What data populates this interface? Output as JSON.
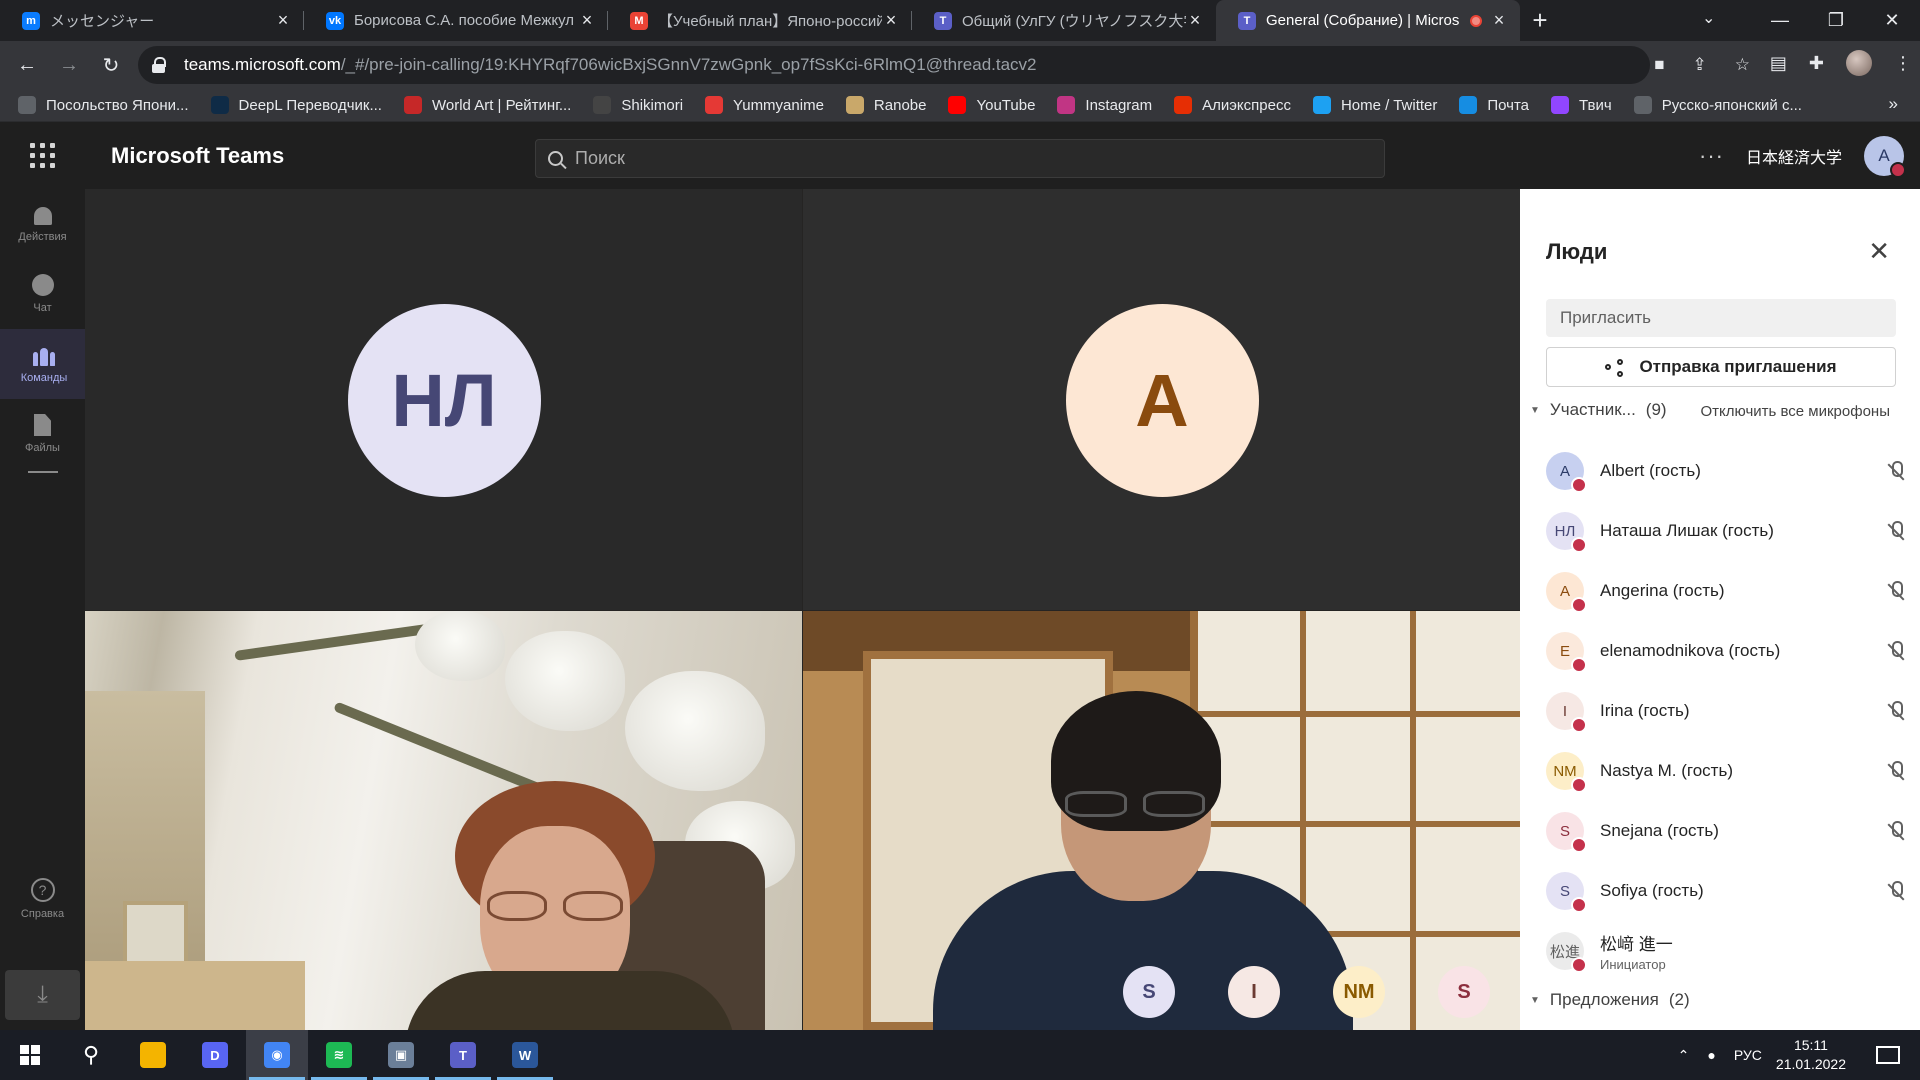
{
  "browser": {
    "tabs": [
      {
        "title": "メッセンジャー",
        "icon": "messenger-icon",
        "color": "#0a7cff",
        "letter": "m"
      },
      {
        "title": "Борисова С.А. пособие Межкул",
        "icon": "vk-icon",
        "color": "#0077ff",
        "letter": "vk"
      },
      {
        "title": "【Учебный план】Японо-россий",
        "icon": "gmail-icon",
        "color": "#ea4335",
        "letter": "M"
      },
      {
        "title": "Общий (УлГУ (ウリヤノフスク大学)",
        "icon": "teams-icon",
        "color": "#5b5fc7",
        "letter": "T"
      },
      {
        "title": "General (Собрание) | Micros",
        "icon": "teams-icon",
        "color": "#5b5fc7",
        "letter": "T"
      }
    ],
    "url_host": "teams.microsoft.com",
    "url_path": "/_#/pre-join-calling/19:KHYRqf706wicBxjSGnnV7zwGpnk_op7fSsKci-6RlmQ1@thread.tacv2",
    "bookmarks": [
      {
        "label": "Посольство Япони...",
        "icon": "globe-icon",
        "color": "#5f6368"
      },
      {
        "label": "DeepL Переводчик...",
        "icon": "deepl-icon",
        "color": "#0f2b46"
      },
      {
        "label": "World Art | Рейтинг...",
        "icon": "worldart-icon",
        "color": "#c62828"
      },
      {
        "label": "Shikimori",
        "icon": "shikimori-icon",
        "color": "#444"
      },
      {
        "label": "Yummyanime",
        "icon": "yummyanime-icon",
        "color": "#e53935"
      },
      {
        "label": "Ranobe",
        "icon": "ranobe-icon",
        "color": "#c9a86a"
      },
      {
        "label": "YouTube",
        "icon": "youtube-icon",
        "color": "#ff0000"
      },
      {
        "label": "Instagram",
        "icon": "instagram-icon",
        "color": "#c13584"
      },
      {
        "label": "Алиэкспресс",
        "icon": "aliexpress-icon",
        "color": "#e62e04"
      },
      {
        "label": "Home / Twitter",
        "icon": "twitter-icon",
        "color": "#1da1f2"
      },
      {
        "label": "Почта",
        "icon": "mail-icon",
        "color": "#168de2"
      },
      {
        "label": "Твич",
        "icon": "twitch-icon",
        "color": "#9146ff"
      },
      {
        "label": "Русско-японский с...",
        "icon": "globe-icon",
        "color": "#5f6368"
      }
    ],
    "bookmarks_more": "»"
  },
  "teams": {
    "app_name": "Microsoft Teams",
    "search_placeholder": "Поиск",
    "org_name": "日本経済大学",
    "me_initial": "A",
    "rail": [
      {
        "label": "Действия",
        "icon": "bell-icon"
      },
      {
        "label": "Чат",
        "icon": "chat-icon"
      },
      {
        "label": "Команды",
        "icon": "teams-icon"
      },
      {
        "label": "Файлы",
        "icon": "file-icon"
      }
    ],
    "help_label": "Справка",
    "tiles": {
      "tile1_initials": "НЛ",
      "tile2_initials": "A"
    },
    "mini_avatars": [
      {
        "initials": "S",
        "bg": "#e4e2f4",
        "fg": "#464775"
      },
      {
        "initials": "I",
        "bg": "#f6e8e4",
        "fg": "#6b3a32"
      },
      {
        "initials": "NM",
        "bg": "#fdeec8",
        "fg": "#8a5a00"
      },
      {
        "initials": "S",
        "bg": "#f9e3e6",
        "fg": "#8c2e3d"
      }
    ]
  },
  "people": {
    "title": "Люди",
    "invite_placeholder": "Пригласить",
    "share_label": "Отправка приглашения",
    "participants_label": "Участник...",
    "participants_count": "(9)",
    "mute_all": "Отключить все микрофоны",
    "participants": [
      {
        "initials": "A",
        "name": "Albert (гость)",
        "bg": "#c7d0f0",
        "fg": "#2b3a66",
        "sub": ""
      },
      {
        "initials": "НЛ",
        "name": "Наташа Лишак (гость)",
        "bg": "#e4e2f4",
        "fg": "#464775",
        "sub": ""
      },
      {
        "initials": "A",
        "name": "Angerina (гость)",
        "bg": "#fde7d4",
        "fg": "#8a4b0e",
        "sub": ""
      },
      {
        "initials": "E",
        "name": "elenamodnikova (гость)",
        "bg": "#fbe9dc",
        "fg": "#8a4b0e",
        "sub": ""
      },
      {
        "initials": "I",
        "name": "Irina (гость)",
        "bg": "#f6e8e4",
        "fg": "#6b3a32",
        "sub": ""
      },
      {
        "initials": "NM",
        "name": "Nastya M. (гость)",
        "bg": "#fdeec8",
        "fg": "#8a5a00",
        "sub": ""
      },
      {
        "initials": "S",
        "name": "Snejana (гость)",
        "bg": "#f9e3e6",
        "fg": "#8c2e3d",
        "sub": ""
      },
      {
        "initials": "S",
        "name": "Sofiya (гость)",
        "bg": "#e4e2f4",
        "fg": "#464775",
        "sub": ""
      },
      {
        "initials": "松進",
        "name": "松﨑 進一",
        "bg": "#ebebeb",
        "fg": "#616161",
        "sub": "Инициатор"
      }
    ],
    "suggestions_label": "Предложения",
    "suggestions_count": "(2)"
  },
  "taskbar": {
    "apps": [
      {
        "name": "explorer-icon",
        "color": "#f4b400",
        "letter": "",
        "open": false
      },
      {
        "name": "discord-icon",
        "color": "#5865f2",
        "letter": "D",
        "open": false
      },
      {
        "name": "chrome-icon",
        "color": "#4285f4",
        "letter": "◉",
        "open": true,
        "active": true
      },
      {
        "name": "spotify-icon",
        "color": "#1db954",
        "letter": "≋",
        "open": true
      },
      {
        "name": "app-icon",
        "color": "#6b7f99",
        "letter": "▣",
        "open": true
      },
      {
        "name": "teams-icon",
        "color": "#5b5fc7",
        "letter": "T",
        "open": true
      },
      {
        "name": "word-icon",
        "color": "#2b579a",
        "letter": "W",
        "open": true
      }
    ],
    "language": "РУС",
    "time": "15:11",
    "date": "21.01.2022"
  }
}
